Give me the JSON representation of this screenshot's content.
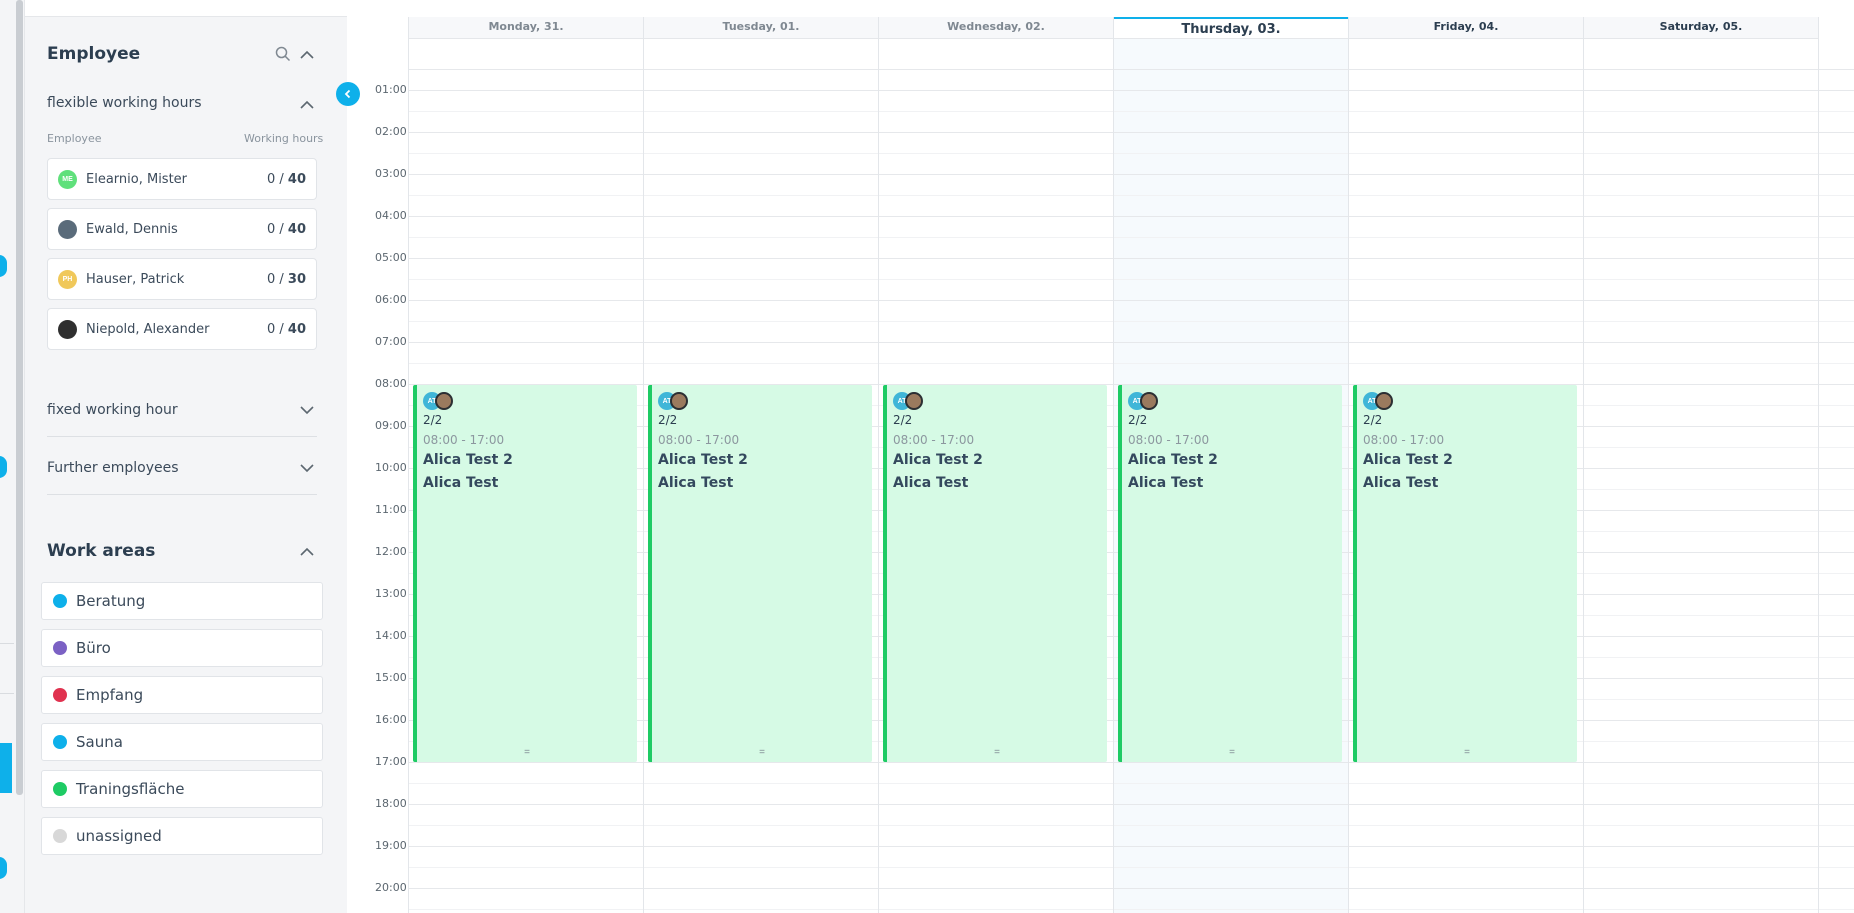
{
  "sidebar": {
    "employee_title": "Employee",
    "flexible": {
      "title": "flexible working hours",
      "col_employee": "Employee",
      "col_hours": "Working hours",
      "employees": [
        {
          "name": "Elearnio, Mister",
          "initials": "ME",
          "avatar_color": "#5fe07b",
          "current": "0",
          "total": "40"
        },
        {
          "name": "Ewald, Dennis",
          "initials": "",
          "avatar_color": "#5a6b7a",
          "current": "0",
          "total": "40"
        },
        {
          "name": "Hauser, Patrick",
          "initials": "PH",
          "avatar_color": "#f0c85a",
          "current": "0",
          "total": "30"
        },
        {
          "name": "Niepold, Alexander",
          "initials": "",
          "avatar_color": "#2f2f2f",
          "current": "0",
          "total": "40"
        }
      ]
    },
    "fixed_title": "fixed working hour",
    "further_title": "Further employees",
    "work_areas_title": "Work areas",
    "work_areas": [
      {
        "label": "Beratung",
        "color": "#0eb0ea"
      },
      {
        "label": "Büro",
        "color": "#7b61c4"
      },
      {
        "label": "Empfang",
        "color": "#e0324f"
      },
      {
        "label": "Sauna",
        "color": "#0eb0ea"
      },
      {
        "label": "Traningsfläche",
        "color": "#1ecb64"
      },
      {
        "label": "unassigned",
        "color": "#d8d8d8"
      }
    ]
  },
  "calendar": {
    "days": [
      "Monday, 31.",
      "Tuesday, 01.",
      "Wednesday, 02.",
      "Thursday, 03.",
      "Friday, 04.",
      "Saturday, 05."
    ],
    "today": "Thursday, 03.",
    "times": [
      "01:00",
      "02:00",
      "03:00",
      "04:00",
      "05:00",
      "06:00",
      "07:00",
      "08:00",
      "09:00",
      "10:00",
      "11:00",
      "12:00",
      "13:00",
      "14:00",
      "15:00",
      "16:00",
      "17:00",
      "18:00",
      "19:00",
      "20:00"
    ],
    "shift": {
      "avatar_initials": "AT",
      "count": "2/2",
      "time": "08:00 - 17:00",
      "line1": "Alica Test 2",
      "line2": "Alica Test",
      "handle": "="
    }
  },
  "colors": {
    "accent": "#0eb0ea",
    "shift_bg": "#d6fae5",
    "shift_border": "#1ecb64"
  }
}
